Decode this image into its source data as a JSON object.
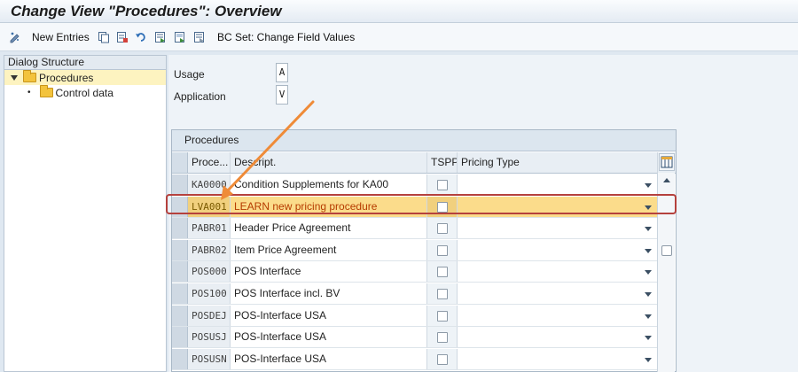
{
  "window": {
    "title": "Change View \"Procedures\": Overview"
  },
  "toolbar": {
    "new_entries": "New Entries",
    "bc_set": "BC Set: Change Field Values"
  },
  "dialog_structure": {
    "header": "Dialog Structure",
    "items": [
      {
        "label": "Procedures",
        "selected": true
      },
      {
        "label": "Control data",
        "selected": false
      }
    ]
  },
  "fields": {
    "usage": {
      "label": "Usage",
      "value": "A"
    },
    "application": {
      "label": "Application",
      "value": "V"
    }
  },
  "table": {
    "caption": "Procedures",
    "columns": [
      "Proce...",
      "Descript.",
      "TSPP",
      "Pricing Type"
    ],
    "rows": [
      {
        "key": "KA0000",
        "desc": "Condition Supplements for KA00"
      },
      {
        "key": "LVA001",
        "desc": "LEARN new pricing procedure"
      },
      {
        "key": "PABR01",
        "desc": "Header Price Agreement"
      },
      {
        "key": "PABR02",
        "desc": "Item Price Agreement"
      },
      {
        "key": "POS000",
        "desc": "POS Interface"
      },
      {
        "key": "POS100",
        "desc": "POS Interface incl. BV"
      },
      {
        "key": "POSDEJ",
        "desc": "POS-Interface USA"
      },
      {
        "key": "POSUSJ",
        "desc": "POS-Interface USA"
      },
      {
        "key": "POSUSN",
        "desc": "POS-Interface USA"
      }
    ]
  },
  "icons": [
    "edit-pencil-icon",
    "copy-icon",
    "delete-icon",
    "undo-icon",
    "select-all-icon",
    "select-block-icon",
    "deselect-icon",
    "column-config-icon",
    "folder-icon",
    "triangle-down-icon"
  ],
  "colors": {
    "selected_row": "#fbdc8b",
    "highlight_border": "#b5413d",
    "arrow": "#ef8b38",
    "selected_text": "#b63c00"
  }
}
